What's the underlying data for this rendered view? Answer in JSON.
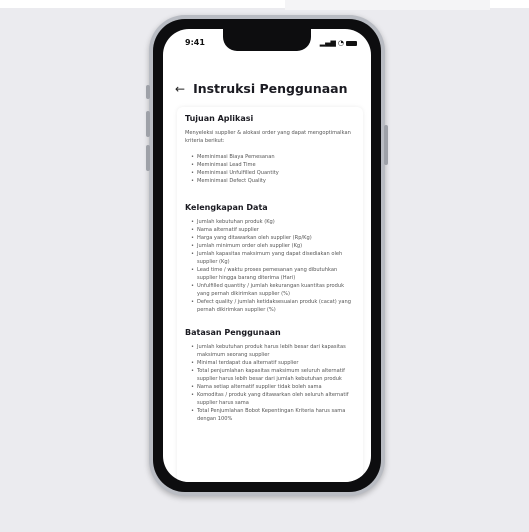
{
  "status_bar": {
    "time": "9:41",
    "signal": "▂▄▆",
    "wifi": "◔"
  },
  "header": {
    "back_icon": "←",
    "title": "Instruksi Penggunaan"
  },
  "sections": [
    {
      "title": "Tujuan Aplikasi",
      "paragraph": "Menyeleksi supplier & alokasi order yang dapat mengoptimalkan kriteria berikut:",
      "items": [
        "Meminimasi Biaya Pemesanan",
        "Meminimasi Lead Time",
        "Meminimasi Unfulfilled Quantity",
        "Meminimasi Defect Quality"
      ]
    },
    {
      "title": "Kelengkapan Data",
      "items": [
        "Jumlah kebutuhan produk (Kg)",
        "Nama alternatif supplier",
        "Harga yang ditawarkan oleh supplier (Rp/Kg)",
        "Jumlah minimum order oleh supplier (Kg)",
        "Jumlah kapasitas maksimum yang dapat disediakan oleh supplier (Kg)",
        "Lead time / waktu proses pemesanan yang dibutuhkan supplier hingga barang diterima (Hari)",
        "Unfulfilled quantity / jumlah kekurangan kuantitas produk yang pernah dikirimkan supplier (%)",
        "Defect quality / jumlah ketidaksesuaian produk (cacat) yang pernah dikirimkan supplier (%)"
      ]
    },
    {
      "title": "Batasan Penggunaan",
      "items": [
        "Jumlah kebutuhan produk harus lebih besar dari kapasitas maksimum seorang supplier",
        "Minimal terdapat dua alternatif supplier",
        "Total penjumlahan kapasitas maksimum seluruh alternatif supplier harus lebih besar dari jumlah kebutuhan produk",
        "Nama setiap alternatif supplier tidak boleh sama",
        "Komoditas / produk yang ditawarkan oleh seluruh alternatif supplier harus sama",
        "Total Penjumlahan Bobot Kepentingan Kriteria harus sama dengan 100%"
      ]
    }
  ]
}
